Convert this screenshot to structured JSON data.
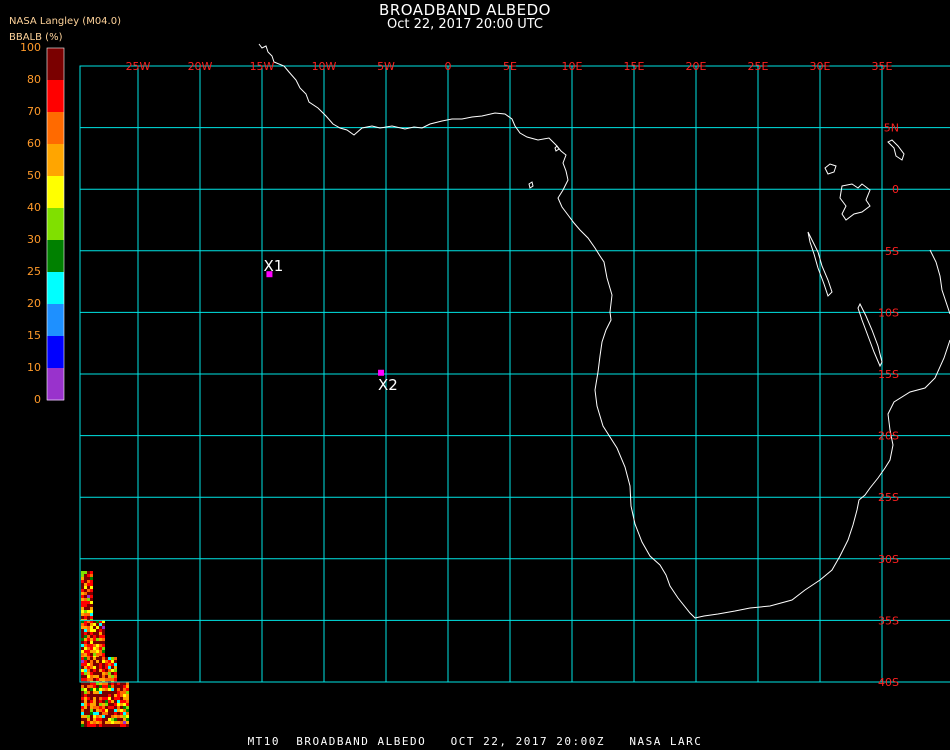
{
  "header": {
    "title": "BROADBAND ALBEDO",
    "datetime": "Oct 22, 2017 20:00 UTC",
    "provider": "NASA Langley (M04.0)"
  },
  "colorbar": {
    "title": "BBALB (%)",
    "levels": [
      {
        "label": "100",
        "color": ""
      },
      {
        "label": "80",
        "color": "#7a0000"
      },
      {
        "label": "70",
        "color": "#ff0000"
      },
      {
        "label": "60",
        "color": "#ff6a00"
      },
      {
        "label": "50",
        "color": "#ffa500"
      },
      {
        "label": "40",
        "color": "#ffff00"
      },
      {
        "label": "30",
        "color": "#80e000"
      },
      {
        "label": "25",
        "color": "#008000"
      },
      {
        "label": "20",
        "color": "#00ffff"
      },
      {
        "label": "15",
        "color": "#1e90ff"
      },
      {
        "label": "10",
        "color": "#0000ff"
      },
      {
        "label": "0",
        "color": "#9932cc"
      }
    ],
    "label_color": "#ff9a2a"
  },
  "map": {
    "longitude_labels": [
      "25W",
      "20W",
      "15W",
      "10W",
      "5W",
      "0",
      "5E",
      "10E",
      "15E",
      "20E",
      "25E",
      "30E",
      "35E"
    ],
    "latitude_labels": [
      "5N",
      "0",
      "5S",
      "10S",
      "15S",
      "20S",
      "25S",
      "30S",
      "35S",
      "40S"
    ],
    "grid_color": "#00e5e5",
    "label_color": "#ff2020",
    "coastline_color": "#ffffff",
    "markers": [
      {
        "label": "X1",
        "lon": -14.4,
        "lat": -6.9,
        "color": "#ff00ff"
      },
      {
        "label": "X2",
        "lon": -5.4,
        "lat": -14.9,
        "color": "#ff00ff"
      }
    ]
  },
  "footer": {
    "text": "MT10  BROADBAND ALBEDO   OCT 22, 2017 20:00Z   NASA LARC"
  }
}
